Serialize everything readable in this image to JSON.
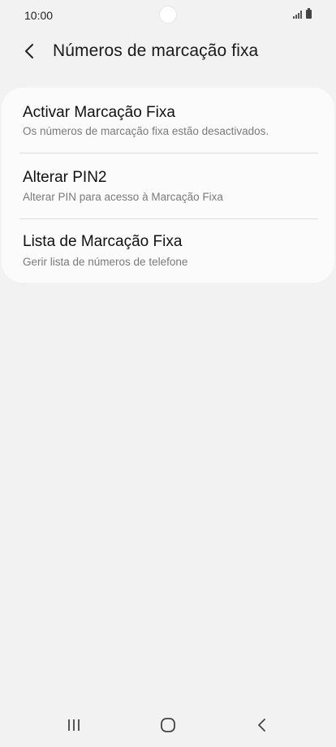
{
  "status_bar": {
    "time": "10:00",
    "icons": [
      "signal-icon",
      "battery-icon"
    ]
  },
  "header": {
    "back_icon": "chevron-left-icon",
    "title": "Números de marcação fixa"
  },
  "settings": {
    "items": [
      {
        "title": "Activar Marcação Fixa",
        "subtitle": "Os números de marcação fixa estão desactivados."
      },
      {
        "title": "Alterar PIN2",
        "subtitle": "Alterar PIN para acesso à Marcação Fixa"
      },
      {
        "title": "Lista de Marcação Fixa",
        "subtitle": "Gerir lista de números de telefone"
      }
    ]
  },
  "nav_bar": {
    "buttons": [
      "recent-apps-icon",
      "home-icon",
      "back-icon"
    ]
  },
  "colors": {
    "background": "#f2f2f2",
    "card": "#fbfbfb",
    "subtitle_text": "#7a7a7a"
  }
}
